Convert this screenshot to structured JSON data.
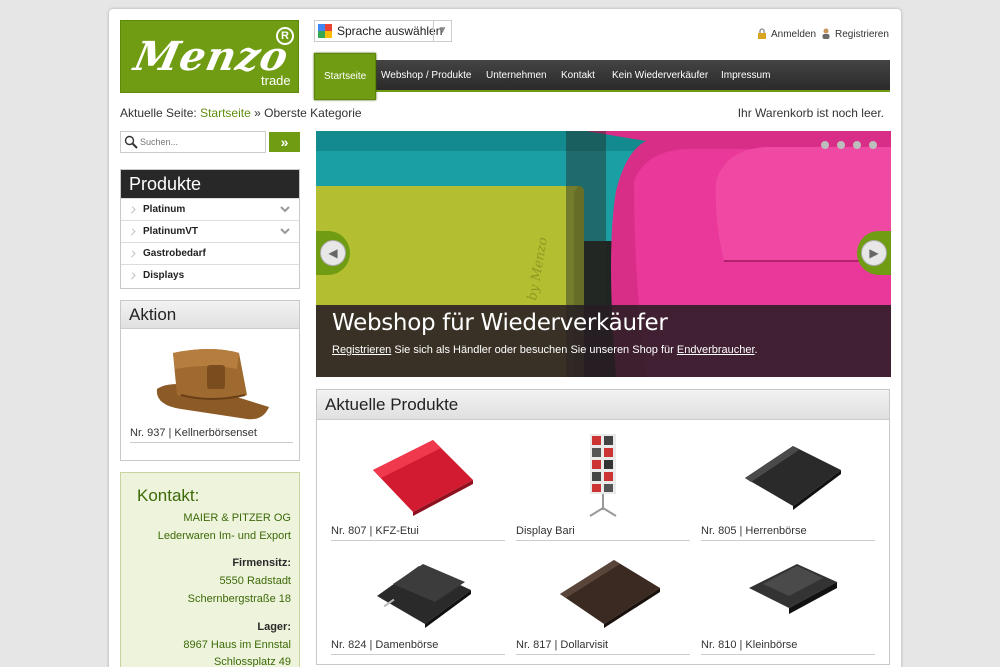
{
  "logo": {
    "brand": "Menzo",
    "sub": "trade",
    "reg": "R"
  },
  "language": {
    "label": "Sprache auswählen"
  },
  "account": {
    "login": "Anmelden",
    "register": "Registrieren"
  },
  "nav": [
    "Startseite",
    "Webshop / Produkte",
    "Unternehmen",
    "Kontakt",
    "Kein Wiederverkäufer",
    "Impressum"
  ],
  "breadcrumb": {
    "prefix": "Aktuelle Seite:",
    "home": "Startseite",
    "sep": "»",
    "current": "Oberste Kategorie"
  },
  "cart": "Ihr Warenkorb ist noch leer.",
  "search": {
    "placeholder": "Suchen...",
    "button": "»"
  },
  "products_box": {
    "title": "Produkte",
    "items": [
      "Platinum",
      "PlatinumVT",
      "Gastrobedarf",
      "Displays"
    ]
  },
  "aktion": {
    "title": "Aktion",
    "caption": "Nr. 937 | Kellnerbörsenset"
  },
  "kontakt": {
    "title": "Kontakt:",
    "company": "MAIER & PITZER OG",
    "desc": "Lederwaren Im- und Export",
    "hq_label": "Firmensitz:",
    "hq_city": "5550 Radstadt",
    "hq_street": "Schernbergstraße 18",
    "lager_label": "Lager:",
    "lager_city": "8967 Haus im Ennstal",
    "lager_street": "Schlossplatz 49"
  },
  "slider": {
    "title": "Webshop für Wiederverkäufer",
    "link1": "Registrieren",
    "text": " Sie sich als Händler oder besuchen Sie unseren Shop für ",
    "link2": "Endverbraucher",
    "end": ".",
    "imprint": "by Menzo"
  },
  "current_products": {
    "title": "Aktuelle Produkte",
    "items": [
      "Nr. 807 | KFZ-Etui",
      "Display Bari",
      "Nr. 805 | Herrenbörse",
      "Nr. 824 | Damenbörse",
      "Nr. 817 | Dollarvisit",
      "Nr. 810 | Kleinbörse"
    ]
  },
  "colors": {
    "accent": "#6f9c12",
    "nav_bg": "#333333",
    "teal": "#1aa0a4",
    "lime": "#b7c235",
    "pink": "#e0318f"
  }
}
